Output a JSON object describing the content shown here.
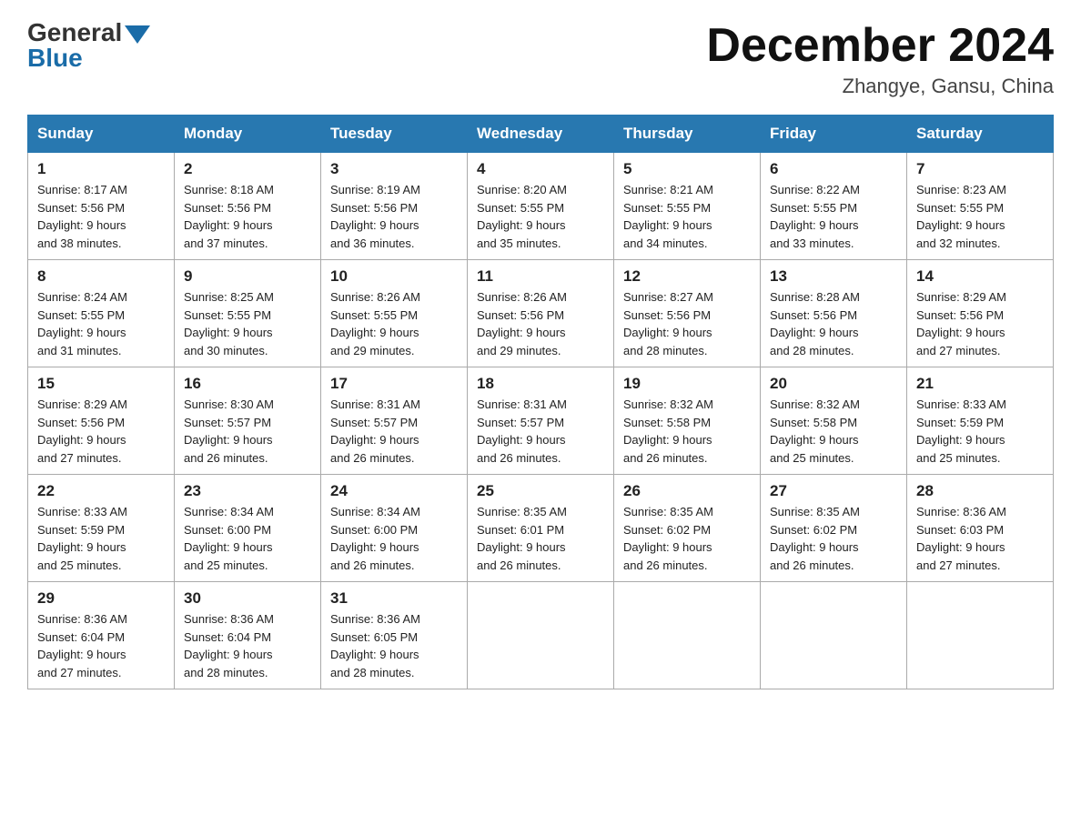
{
  "header": {
    "logo_general": "General",
    "logo_blue": "Blue",
    "month_title": "December 2024",
    "subtitle": "Zhangye, Gansu, China"
  },
  "weekdays": [
    "Sunday",
    "Monday",
    "Tuesday",
    "Wednesday",
    "Thursday",
    "Friday",
    "Saturday"
  ],
  "weeks": [
    [
      {
        "day": "1",
        "info": "Sunrise: 8:17 AM\nSunset: 5:56 PM\nDaylight: 9 hours\nand 38 minutes."
      },
      {
        "day": "2",
        "info": "Sunrise: 8:18 AM\nSunset: 5:56 PM\nDaylight: 9 hours\nand 37 minutes."
      },
      {
        "day": "3",
        "info": "Sunrise: 8:19 AM\nSunset: 5:56 PM\nDaylight: 9 hours\nand 36 minutes."
      },
      {
        "day": "4",
        "info": "Sunrise: 8:20 AM\nSunset: 5:55 PM\nDaylight: 9 hours\nand 35 minutes."
      },
      {
        "day": "5",
        "info": "Sunrise: 8:21 AM\nSunset: 5:55 PM\nDaylight: 9 hours\nand 34 minutes."
      },
      {
        "day": "6",
        "info": "Sunrise: 8:22 AM\nSunset: 5:55 PM\nDaylight: 9 hours\nand 33 minutes."
      },
      {
        "day": "7",
        "info": "Sunrise: 8:23 AM\nSunset: 5:55 PM\nDaylight: 9 hours\nand 32 minutes."
      }
    ],
    [
      {
        "day": "8",
        "info": "Sunrise: 8:24 AM\nSunset: 5:55 PM\nDaylight: 9 hours\nand 31 minutes."
      },
      {
        "day": "9",
        "info": "Sunrise: 8:25 AM\nSunset: 5:55 PM\nDaylight: 9 hours\nand 30 minutes."
      },
      {
        "day": "10",
        "info": "Sunrise: 8:26 AM\nSunset: 5:55 PM\nDaylight: 9 hours\nand 29 minutes."
      },
      {
        "day": "11",
        "info": "Sunrise: 8:26 AM\nSunset: 5:56 PM\nDaylight: 9 hours\nand 29 minutes."
      },
      {
        "day": "12",
        "info": "Sunrise: 8:27 AM\nSunset: 5:56 PM\nDaylight: 9 hours\nand 28 minutes."
      },
      {
        "day": "13",
        "info": "Sunrise: 8:28 AM\nSunset: 5:56 PM\nDaylight: 9 hours\nand 28 minutes."
      },
      {
        "day": "14",
        "info": "Sunrise: 8:29 AM\nSunset: 5:56 PM\nDaylight: 9 hours\nand 27 minutes."
      }
    ],
    [
      {
        "day": "15",
        "info": "Sunrise: 8:29 AM\nSunset: 5:56 PM\nDaylight: 9 hours\nand 27 minutes."
      },
      {
        "day": "16",
        "info": "Sunrise: 8:30 AM\nSunset: 5:57 PM\nDaylight: 9 hours\nand 26 minutes."
      },
      {
        "day": "17",
        "info": "Sunrise: 8:31 AM\nSunset: 5:57 PM\nDaylight: 9 hours\nand 26 minutes."
      },
      {
        "day": "18",
        "info": "Sunrise: 8:31 AM\nSunset: 5:57 PM\nDaylight: 9 hours\nand 26 minutes."
      },
      {
        "day": "19",
        "info": "Sunrise: 8:32 AM\nSunset: 5:58 PM\nDaylight: 9 hours\nand 26 minutes."
      },
      {
        "day": "20",
        "info": "Sunrise: 8:32 AM\nSunset: 5:58 PM\nDaylight: 9 hours\nand 25 minutes."
      },
      {
        "day": "21",
        "info": "Sunrise: 8:33 AM\nSunset: 5:59 PM\nDaylight: 9 hours\nand 25 minutes."
      }
    ],
    [
      {
        "day": "22",
        "info": "Sunrise: 8:33 AM\nSunset: 5:59 PM\nDaylight: 9 hours\nand 25 minutes."
      },
      {
        "day": "23",
        "info": "Sunrise: 8:34 AM\nSunset: 6:00 PM\nDaylight: 9 hours\nand 25 minutes."
      },
      {
        "day": "24",
        "info": "Sunrise: 8:34 AM\nSunset: 6:00 PM\nDaylight: 9 hours\nand 26 minutes."
      },
      {
        "day": "25",
        "info": "Sunrise: 8:35 AM\nSunset: 6:01 PM\nDaylight: 9 hours\nand 26 minutes."
      },
      {
        "day": "26",
        "info": "Sunrise: 8:35 AM\nSunset: 6:02 PM\nDaylight: 9 hours\nand 26 minutes."
      },
      {
        "day": "27",
        "info": "Sunrise: 8:35 AM\nSunset: 6:02 PM\nDaylight: 9 hours\nand 26 minutes."
      },
      {
        "day": "28",
        "info": "Sunrise: 8:36 AM\nSunset: 6:03 PM\nDaylight: 9 hours\nand 27 minutes."
      }
    ],
    [
      {
        "day": "29",
        "info": "Sunrise: 8:36 AM\nSunset: 6:04 PM\nDaylight: 9 hours\nand 27 minutes."
      },
      {
        "day": "30",
        "info": "Sunrise: 8:36 AM\nSunset: 6:04 PM\nDaylight: 9 hours\nand 28 minutes."
      },
      {
        "day": "31",
        "info": "Sunrise: 8:36 AM\nSunset: 6:05 PM\nDaylight: 9 hours\nand 28 minutes."
      },
      {
        "day": "",
        "info": ""
      },
      {
        "day": "",
        "info": ""
      },
      {
        "day": "",
        "info": ""
      },
      {
        "day": "",
        "info": ""
      }
    ]
  ]
}
